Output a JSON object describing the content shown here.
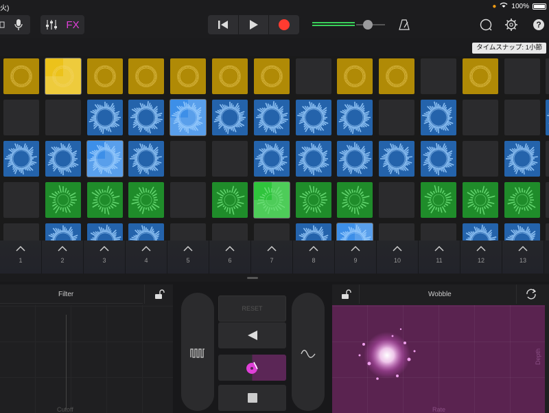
{
  "status": {
    "time": "火)",
    "battery": "100%"
  },
  "toolbar": {
    "fx_label": "FX"
  },
  "snap": {
    "label": "タイムスナップ: 1小節"
  },
  "colors": {
    "yellow": "#b08a06",
    "yellow_active": "#ecc21a",
    "blue": "#2463ab",
    "blue_active": "#3d8fe8",
    "green": "#1f8c2a",
    "green_active": "#2fc43c",
    "empty": "#2b2b2d",
    "purple": "#5a2350",
    "accent_record": "#ff3b30",
    "accent_fx": "#e040d8"
  },
  "rows": [
    {
      "color": "yellow",
      "cells": [
        1,
        2,
        1,
        1,
        1,
        1,
        1,
        0,
        1,
        1,
        0,
        1,
        0,
        0
      ]
    },
    {
      "color": "blue",
      "cells": [
        0,
        0,
        1,
        1,
        2,
        1,
        1,
        1,
        1,
        0,
        1,
        0,
        0,
        1
      ]
    },
    {
      "color": "blue",
      "cells": [
        1,
        1,
        2,
        1,
        0,
        0,
        1,
        1,
        1,
        1,
        1,
        0,
        1,
        0
      ]
    },
    {
      "color": "green",
      "cells": [
        0,
        1,
        1,
        1,
        0,
        1,
        2,
        1,
        1,
        0,
        1,
        1,
        1,
        0
      ]
    },
    {
      "color": "blue",
      "cells": [
        0,
        1,
        1,
        1,
        0,
        0,
        0,
        1,
        2,
        0,
        0,
        1,
        1,
        0
      ]
    }
  ],
  "triggers": [
    "1",
    "2",
    "3",
    "4",
    "5",
    "6",
    "7",
    "8",
    "9",
    "10",
    "11",
    "12",
    "13"
  ],
  "left_panel": {
    "title": "Filter",
    "x_label": "Cutoff"
  },
  "right_panel": {
    "title": "Wobble",
    "x_label": "Rate",
    "y_label": "Depth"
  },
  "center": {
    "reset_label": "RESET"
  }
}
